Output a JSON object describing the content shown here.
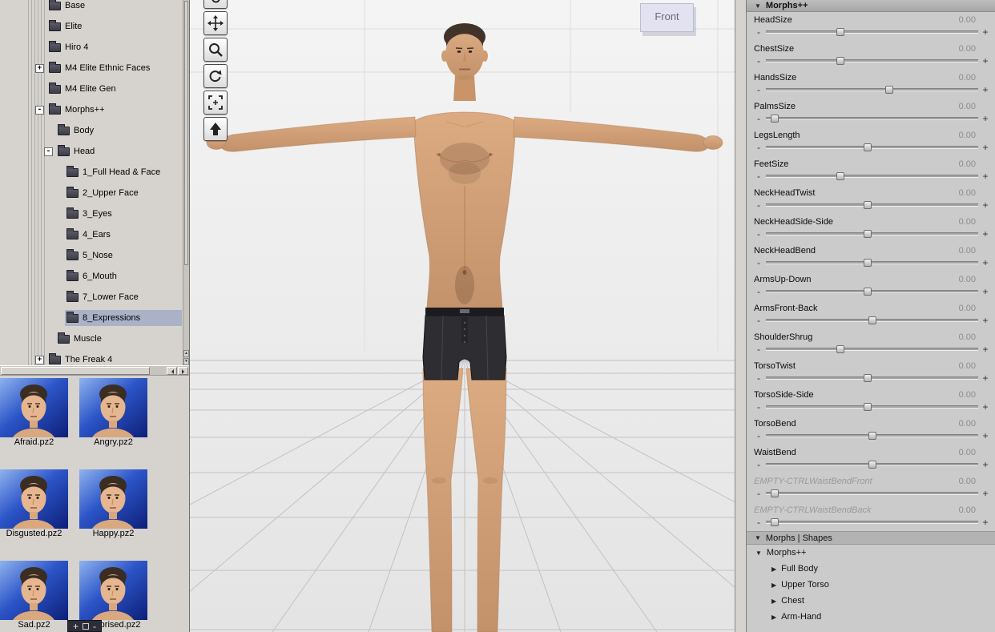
{
  "icons": {
    "down_triangle": "▼",
    "right_triangle": "▶"
  },
  "tree": {
    "items": [
      {
        "label": "Base",
        "level": 0,
        "expander": ""
      },
      {
        "label": "Elite",
        "level": 0,
        "expander": ""
      },
      {
        "label": "Hiro 4",
        "level": 0,
        "expander": ""
      },
      {
        "label": "M4 Elite Ethnic Faces",
        "level": 0,
        "expander": "+"
      },
      {
        "label": "M4 Elite Gen",
        "level": 0,
        "expander": ""
      },
      {
        "label": "Morphs++",
        "level": 0,
        "expander": "-"
      },
      {
        "label": "Body",
        "level": 1,
        "expander": ""
      },
      {
        "label": "Head",
        "level": 1,
        "expander": "-"
      },
      {
        "label": "1_Full Head & Face",
        "level": 2,
        "expander": ""
      },
      {
        "label": "2_Upper Face",
        "level": 2,
        "expander": ""
      },
      {
        "label": "3_Eyes",
        "level": 2,
        "expander": ""
      },
      {
        "label": "4_Ears",
        "level": 2,
        "expander": ""
      },
      {
        "label": "5_Nose",
        "level": 2,
        "expander": ""
      },
      {
        "label": "6_Mouth",
        "level": 2,
        "expander": ""
      },
      {
        "label": "7_Lower Face",
        "level": 2,
        "expander": ""
      },
      {
        "label": "8_Expressions",
        "level": 2,
        "expander": "",
        "selected": true
      },
      {
        "label": "Muscle",
        "level": 1,
        "expander": ""
      },
      {
        "label": "The Freak 4",
        "level": 0,
        "expander": "+"
      }
    ]
  },
  "thumbnails": {
    "items": [
      {
        "label": "Afraid.pz2"
      },
      {
        "label": "Angry.pz2"
      },
      {
        "label": "Disgusted.pz2"
      },
      {
        "label": "Happy.pz2"
      },
      {
        "label": "Sad.pz2"
      },
      {
        "label": "Surprised.pz2"
      }
    ],
    "add_label": "+",
    "remove_label": "-"
  },
  "viewport": {
    "camera_label": "Front",
    "toolbar": [
      "hand-tool",
      "move-tool",
      "zoom-tool",
      "rotate-tool",
      "frame-tool",
      "orbit-tool"
    ]
  },
  "params": {
    "header": "Morphs++",
    "minus_label": "-",
    "plus_label": "+",
    "sliders": [
      {
        "label": "HeadSize",
        "value": "0.00",
        "thumb": 35
      },
      {
        "label": "ChestSize",
        "value": "0.00",
        "thumb": 35
      },
      {
        "label": "HandsSize",
        "value": "0.00",
        "thumb": 58
      },
      {
        "label": "PalmsSize",
        "value": "0.00",
        "thumb": 4
      },
      {
        "label": "LegsLength",
        "value": "0.00",
        "thumb": 48
      },
      {
        "label": "FeetSize",
        "value": "0.00",
        "thumb": 35
      },
      {
        "label": "NeckHeadTwist",
        "value": "0.00",
        "thumb": 48
      },
      {
        "label": "NeckHeadSide-Side",
        "value": "0.00",
        "thumb": 48
      },
      {
        "label": "NeckHeadBend",
        "value": "0.00",
        "thumb": 48
      },
      {
        "label": "ArmsUp-Down",
        "value": "0.00",
        "thumb": 48
      },
      {
        "label": "ArmsFront-Back",
        "value": "0.00",
        "thumb": 50
      },
      {
        "label": "ShoulderShrug",
        "value": "0.00",
        "thumb": 35
      },
      {
        "label": "TorsoTwist",
        "value": "0.00",
        "thumb": 48
      },
      {
        "label": "TorsoSide-Side",
        "value": "0.00",
        "thumb": 48
      },
      {
        "label": "TorsoBend",
        "value": "0.00",
        "thumb": 50
      },
      {
        "label": "WaistBend",
        "value": "0.00",
        "thumb": 50
      },
      {
        "label": "EMPTY-CTRLWaistBendFront",
        "value": "0.00",
        "thumb": 4,
        "empty": true
      },
      {
        "label": "EMPTY-CTRLWaistBendBack",
        "value": "0.00",
        "thumb": 4,
        "empty": true
      }
    ]
  },
  "groups": {
    "section": "Morphs | Shapes",
    "subsection": "Morphs++",
    "items": [
      {
        "label": "Full Body"
      },
      {
        "label": "Upper Torso"
      },
      {
        "label": "Chest"
      },
      {
        "label": "Arm-Hand"
      }
    ]
  },
  "colors": {
    "selection": "#a9b2c6",
    "skin": "#d4a179",
    "shorts": "#2e2e32",
    "thumb_gradient_top": "#8fb2ee",
    "thumb_gradient_bottom": "#0d1f78",
    "panel_bg": "#d6d3ce",
    "params_bg": "#cbcbcb"
  }
}
